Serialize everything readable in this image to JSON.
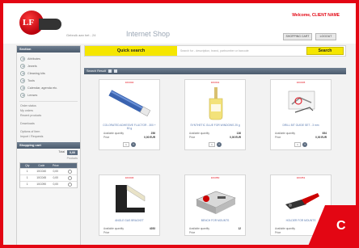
{
  "header": {
    "logo_text": "LF",
    "tagline": "Gebruik aan het - 24",
    "shop_title": "Internet Shop",
    "welcome": "Welcome, CLIENT NAME",
    "cart_button": "SHOPPING CART",
    "logout_button": "LOGOUT"
  },
  "sidebar": {
    "categories_title": "Section",
    "categories": [
      "Attributes",
      "Jewels",
      "Cleaning kits",
      "Tools",
      "Calendar, agenda etc.",
      "Lenses"
    ],
    "links": [
      "Order status",
      "My orders",
      "Recent products"
    ],
    "extra_link": "Downloads",
    "info_links": [
      "Options of Item",
      "Import / Requests"
    ],
    "cart_title": "Shopping cart",
    "cart_total_label": "Total",
    "cart_total_value": "0,00",
    "cart_sub": "Products",
    "cart_columns": [
      "Qty",
      "Code",
      "Price",
      ""
    ],
    "cart_rows": [
      {
        "qty": "1",
        "code": "10C040",
        "price": "0,00"
      },
      {
        "qty": "1",
        "code": "10C045",
        "price": "0,00"
      },
      {
        "qty": "1",
        "code": "10C090",
        "price": "0,00"
      }
    ]
  },
  "search": {
    "label": "Quick search",
    "placeholder": "Search for - description, brand, partnumber or barcode",
    "button": "Search"
  },
  "results": {
    "label": "Search Result"
  },
  "products": [
    {
      "code": "10C040",
      "name": "COLORATED ADHESIVE FLUCTOR - 300 + 50 g",
      "qty_label": "Available quantity",
      "qty_value": "256",
      "price_label": "Price",
      "price_value": "0,00 EUR",
      "order_qty": "1"
    },
    {
      "code": "10C041",
      "name": "SYNTHETIC GLUE FOR WINDOWS 25 g",
      "qty_label": "Available quantity",
      "qty_value": "136",
      "price_label": "Price",
      "price_value": "0,00 EUR",
      "order_qty": "1"
    },
    {
      "code": "10C045",
      "name": "DRILL BIT GUIDE SET - 3 mm",
      "qty_label": "Available quantity",
      "qty_value": "654",
      "price_label": "Price",
      "price_value": "0,00 EUR",
      "order_qty": "1"
    },
    {
      "code": "10C046",
      "name": "ANGLE GAS BRACKET",
      "qty_label": "Available quantity",
      "qty_value": "4283",
      "price_label": "Price",
      "price_value": "",
      "order_qty": "1"
    },
    {
      "code": "10C050",
      "name": "BENCH FOR MOUNTS",
      "qty_label": "Available quantity",
      "qty_value": "12",
      "price_label": "Price",
      "price_value": "",
      "order_qty": "1"
    },
    {
      "code": "10C051",
      "name": "HOLDER FOR MOUNTS",
      "qty_label": "Available quantity",
      "qty_value": "78",
      "price_label": "Price",
      "price_value": "",
      "order_qty": "1"
    }
  ],
  "corner_badge": "C",
  "colors": {
    "brand_red": "#e30613",
    "search_yellow": "#f5e600",
    "panel_slate": "#5d6d80"
  }
}
